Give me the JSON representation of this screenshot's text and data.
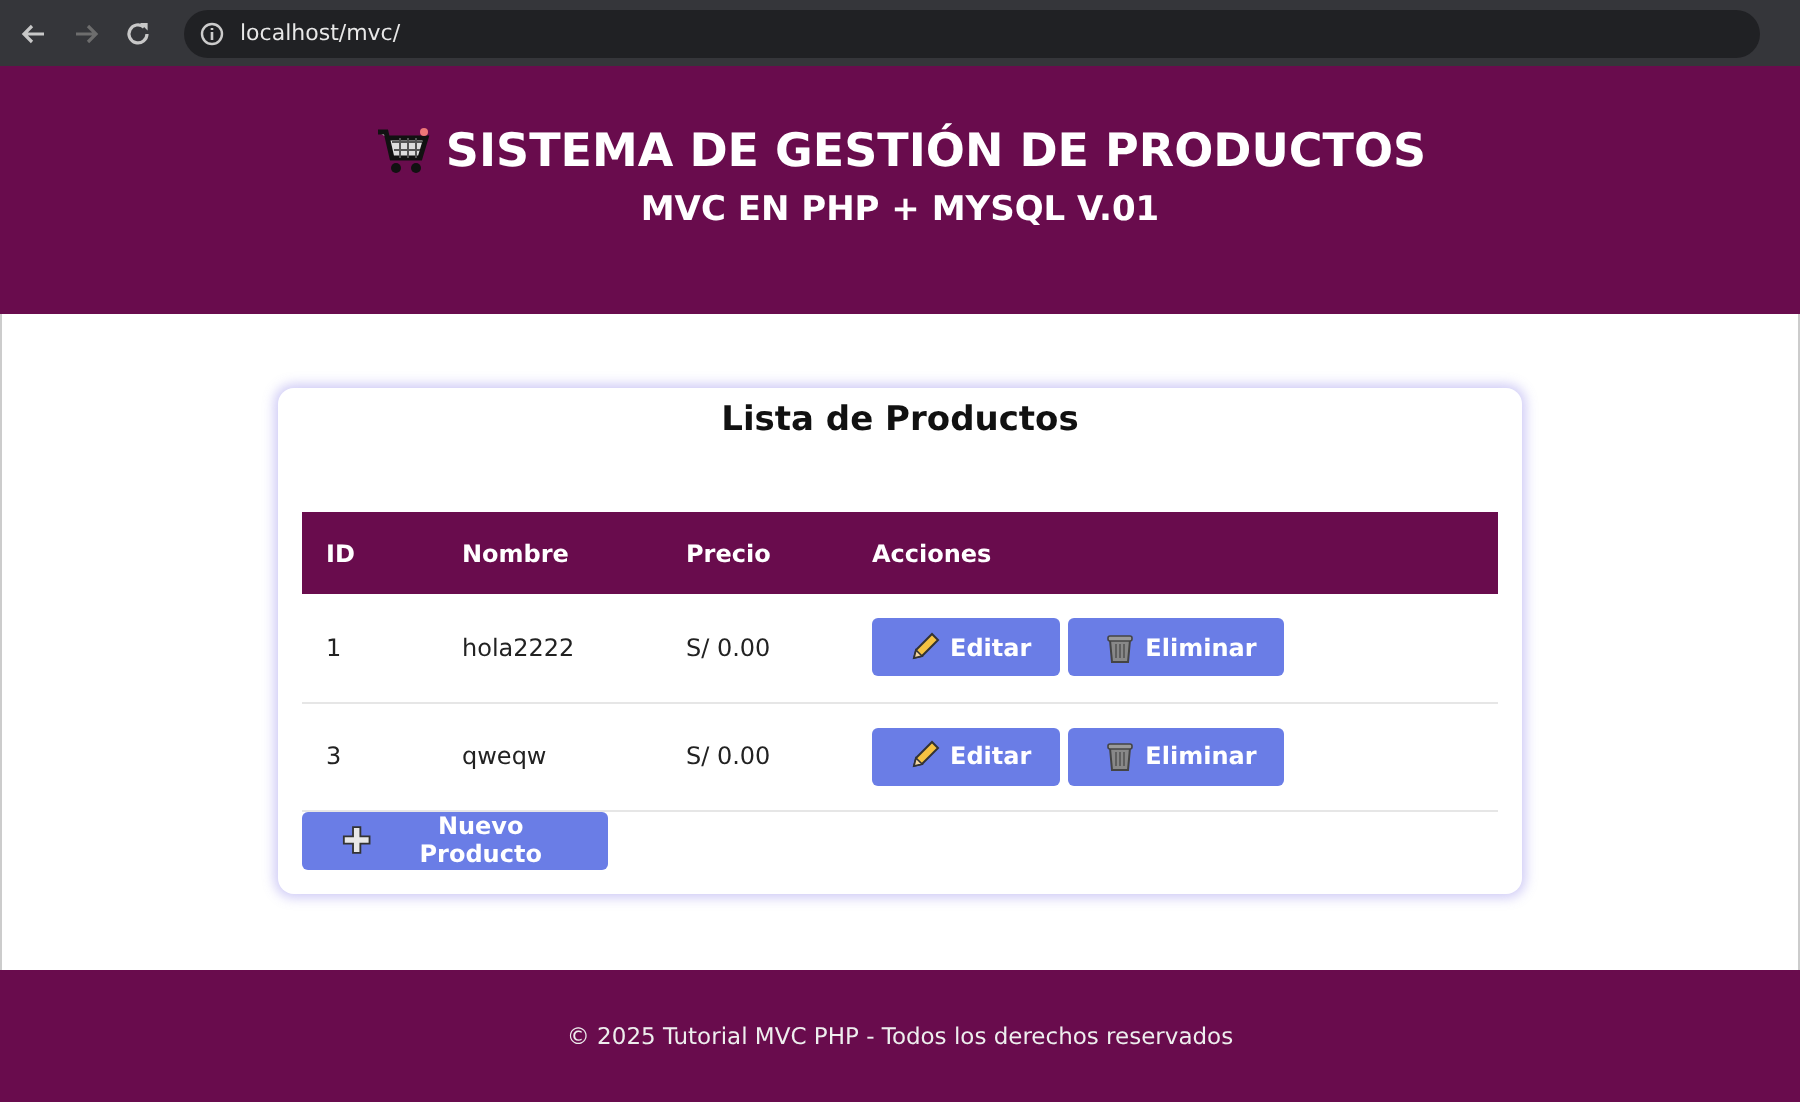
{
  "browser": {
    "url": "localhost/mvc/"
  },
  "header": {
    "title": "SISTEMA DE GESTIÓN DE PRODUCTOS",
    "subtitle": "MVC EN PHP + MYSQL V.01"
  },
  "card": {
    "title": "Lista de Productos",
    "table": {
      "columns": [
        "ID",
        "Nombre",
        "Precio",
        "Acciones"
      ],
      "rows": [
        {
          "cells": [
            "1",
            "hola2222",
            "S/ 0.00"
          ],
          "actions": [
            {
              "kind": "edit",
              "label": "Editar"
            },
            {
              "kind": "delete",
              "label": "Eliminar"
            }
          ]
        },
        {
          "cells": [
            "3",
            "qweqw",
            "S/ 0.00"
          ],
          "actions": [
            {
              "kind": "edit",
              "label": "Editar"
            },
            {
              "kind": "delete",
              "label": "Eliminar"
            }
          ]
        }
      ]
    },
    "new_button": "Nuevo Producto"
  },
  "footer": {
    "text": "© 2025 Tutorial MVC PHP - Todos los derechos reservados"
  }
}
